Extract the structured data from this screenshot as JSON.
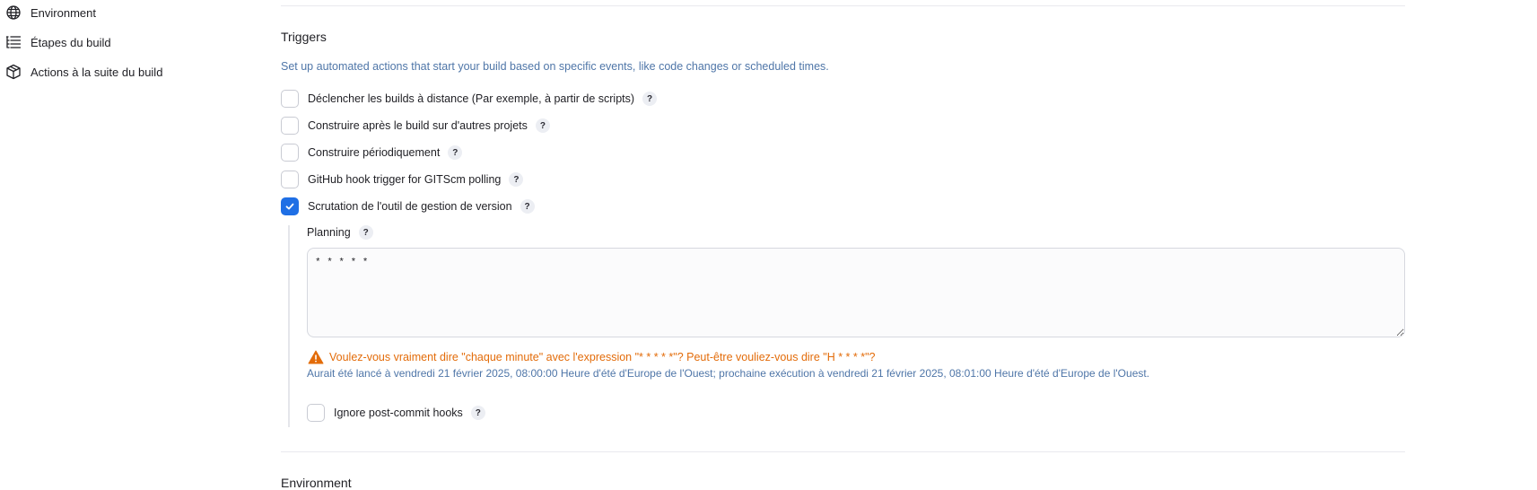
{
  "sidebar": {
    "items": [
      {
        "label": "Environment",
        "icon": "globe-icon"
      },
      {
        "label": "Étapes du build",
        "icon": "list-icon"
      },
      {
        "label": "Actions à la suite du build",
        "icon": "package-icon"
      }
    ]
  },
  "triggers": {
    "title": "Triggers",
    "description": "Set up automated actions that start your build based on specific events, like code changes or scheduled times.",
    "options": [
      {
        "label": "Déclencher les builds à distance (Par exemple, à partir de scripts)",
        "checked": false
      },
      {
        "label": "Construire après le build sur d'autres projets",
        "checked": false
      },
      {
        "label": "Construire périodiquement",
        "checked": false
      },
      {
        "label": "GitHub hook trigger for GITScm polling",
        "checked": false
      },
      {
        "label": "Scrutation de l'outil de gestion de version",
        "checked": true
      }
    ],
    "planning": {
      "label": "Planning",
      "value": "* * * * *",
      "warning": "Voulez-vous vraiment dire \"chaque minute\" avec l'expression  \"* * * * *\"? Peut-être vouliez-vous dire \"H * * * *\"?",
      "info": "Aurait été lancé à vendredi 21 février 2025, 08:00:00 Heure d'été d'Europe de l'Ouest; prochaine exécution à vendredi 21 février 2025, 08:01:00 Heure d'été d'Europe de l'Ouest."
    },
    "ignore_hooks": {
      "label": "Ignore post-commit hooks",
      "checked": false
    },
    "help_glyph": "?"
  },
  "environment": {
    "title": "Environment"
  },
  "colors": {
    "accent": "#1f6fe5",
    "warning": "#e36c0a",
    "info": "#4f76a8"
  }
}
